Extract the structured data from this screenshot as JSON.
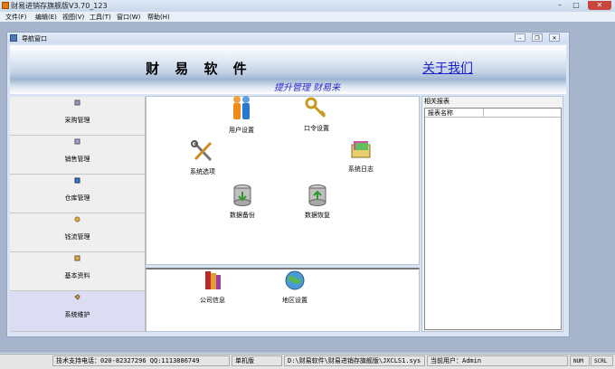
{
  "app": {
    "title": "财易进销存旗舰版V3.70_123"
  },
  "menu": [
    "文件(F)",
    "编辑(E)",
    "视图(V)",
    "工具(T)",
    "窗口(W)",
    "帮助(H)"
  ],
  "child_window": {
    "title": "导航窗口"
  },
  "banner": {
    "brand": "财 易 软 件",
    "about_link": "关于我们",
    "slogan": "提升管理 财易来"
  },
  "nav": {
    "items": [
      {
        "label": "采购管理",
        "icon": "purchase-icon"
      },
      {
        "label": "销售管理",
        "icon": "sales-icon"
      },
      {
        "label": "仓库管理",
        "icon": "warehouse-icon"
      },
      {
        "label": "钱流管理",
        "icon": "cashflow-icon"
      },
      {
        "label": "基本资料",
        "icon": "basic-data-icon"
      },
      {
        "label": "系统维护",
        "icon": "system-maintenance-icon"
      }
    ],
    "active": "系统维护"
  },
  "functions": {
    "user_settings": "用户设置",
    "password_settings": "口令设置",
    "system_options": "系统选项",
    "system_log": "系统日志",
    "data_backup": "数据备份",
    "data_restore": "数据恢复",
    "company_info": "公司信息",
    "region_settings": "地区设置"
  },
  "right_panel": {
    "title": "相关报表",
    "column": "报表名称"
  },
  "status": {
    "support": "技术支持电话：020-82327296 QQ:1113886749",
    "mode": "单机版",
    "path": "D:\\财易软件\\财易进销存旗舰版\\JXCLS1.sys",
    "user": "当前用户：Admin",
    "num": "NUM",
    "scrl": "SCRL"
  },
  "colors": {
    "accent_link": "#1a22c8",
    "slogan": "#2a2acc"
  }
}
